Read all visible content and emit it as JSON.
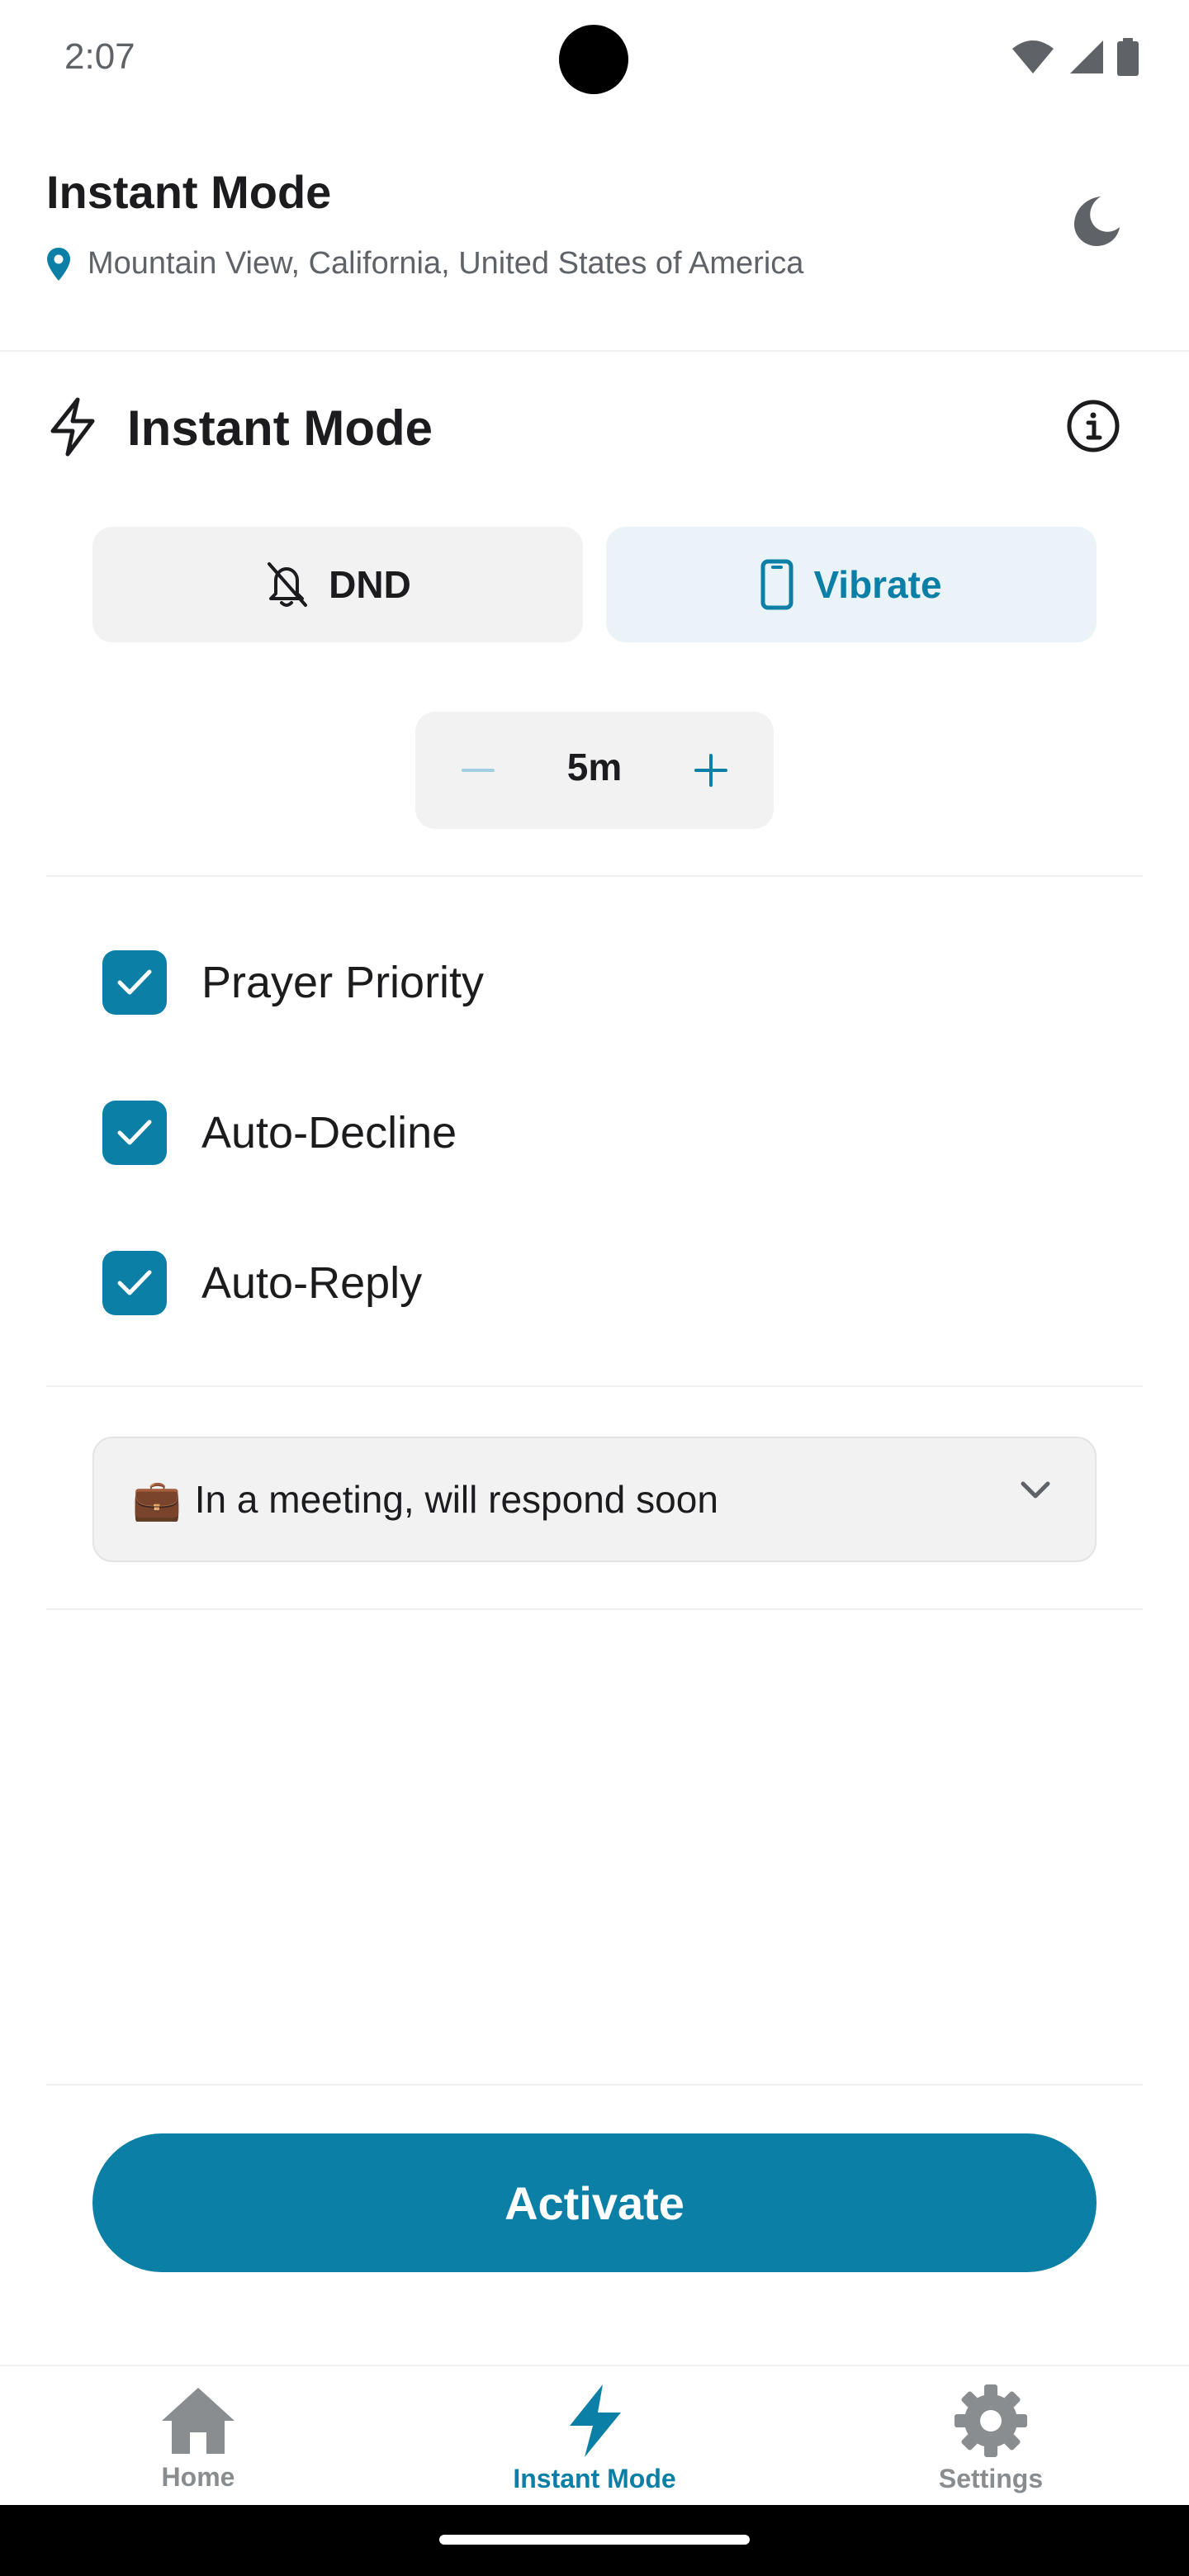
{
  "status_bar": {
    "time": "2:07"
  },
  "header": {
    "title": "Instant Mode",
    "location": "Mountain View, California, United States of America",
    "location_icon": "location-pin-icon",
    "theme_icon": "moon-icon"
  },
  "section": {
    "title": "Instant Mode",
    "title_icon": "bolt-outline-icon",
    "info_icon": "info-icon"
  },
  "modes": {
    "dnd_label": "DND",
    "vibrate_label": "Vibrate",
    "selected": "Vibrate"
  },
  "duration": {
    "value": "5m"
  },
  "options": [
    {
      "label": "Prayer Priority",
      "checked": true
    },
    {
      "label": "Auto-Decline",
      "checked": true
    },
    {
      "label": "Auto-Reply",
      "checked": true
    }
  ],
  "auto_reply": {
    "emoji": "💼",
    "message": "In a meeting, will respond soon"
  },
  "activate_label": "Activate",
  "bottom_nav": {
    "items": [
      {
        "label": "Home",
        "icon": "home-icon",
        "active": false
      },
      {
        "label": "Instant Mode",
        "icon": "bolt-icon",
        "active": true
      },
      {
        "label": "Settings",
        "icon": "gear-icon",
        "active": false
      }
    ]
  },
  "colors": {
    "accent": "#0b7fa6",
    "chip_bg": "#f2f2f3",
    "selected_chip_bg": "#eaf3f7",
    "inactive_nav": "#8a8d90"
  }
}
